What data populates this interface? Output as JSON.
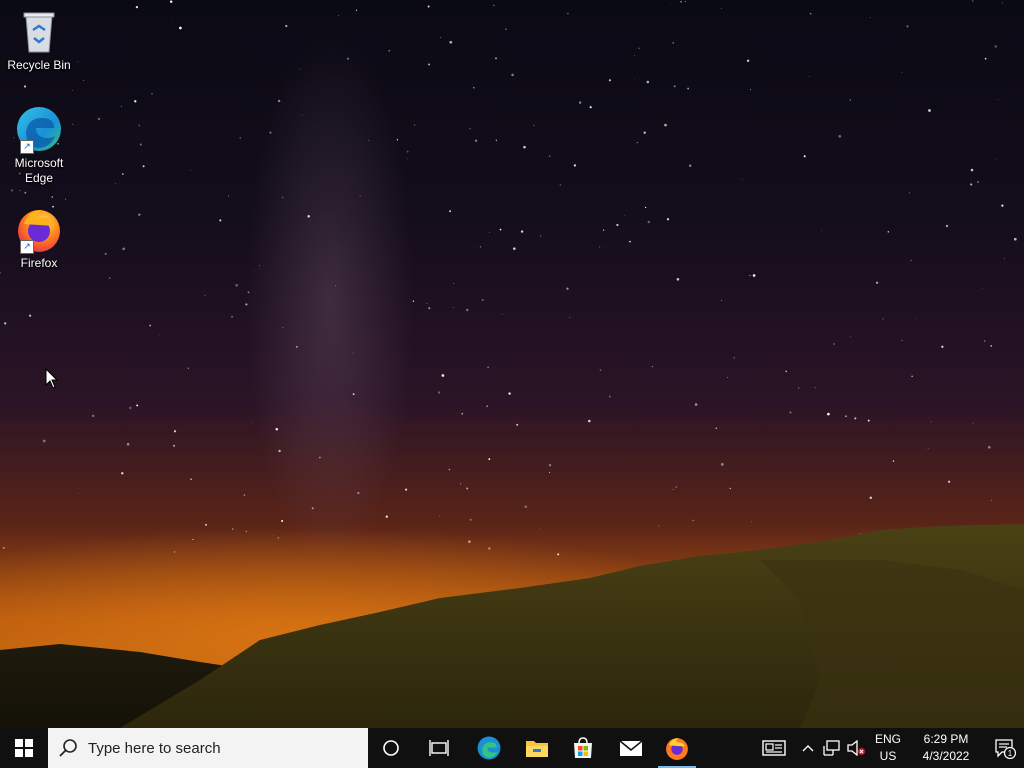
{
  "desktop": {
    "icons": [
      {
        "label": "Recycle Bin"
      },
      {
        "label": "Microsoft Edge"
      },
      {
        "label": "Firefox"
      }
    ]
  },
  "taskbar": {
    "search": {
      "placeholder": "Type here to search"
    },
    "pinned": [
      {
        "name": "Task View",
        "icon": "task-view-icon"
      },
      {
        "name": "Microsoft Edge",
        "icon": "edge-icon"
      },
      {
        "name": "File Explorer",
        "icon": "folder-icon"
      },
      {
        "name": "Microsoft Store",
        "icon": "store-icon"
      },
      {
        "name": "Mail",
        "icon": "mail-icon"
      },
      {
        "name": "Firefox",
        "icon": "firefox-icon",
        "active": true
      }
    ],
    "tray": {
      "language_line1": "ENG",
      "language_line2": "US",
      "time": "6:29 PM",
      "date": "4/3/2022",
      "notification_count": "1"
    }
  },
  "colors": {
    "taskbar": "#101010",
    "search_bg": "#f3f3f3",
    "accent": "#76b9ed"
  }
}
